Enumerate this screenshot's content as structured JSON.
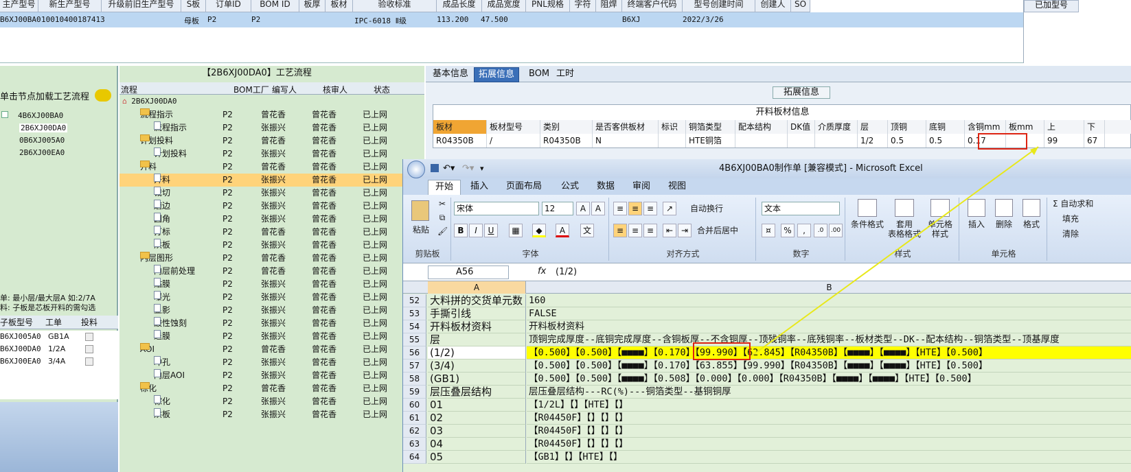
{
  "top_grid": {
    "headers": [
      "主产型号",
      "新生产型号",
      "升级前旧生产型号",
      "S板",
      "订单ID",
      "BOM ID",
      "板厚",
      "板材",
      "验收标准",
      "成品长度",
      "成品宽度",
      "PNL规格",
      "字符",
      "阻焊",
      "终端客户代码",
      "型号创建时间",
      "创建人",
      "SO"
    ],
    "row": {
      "model": "B6XJ00BA0",
      "new_model": "10010400187413",
      "board_type": "母板",
      "order": "P2",
      "bom": "P2",
      "standard": "IPC-6018 Ⅱ级",
      "length": "113.200",
      "width": "47.500",
      "customer": "B6XJ",
      "created": "2022/3/26"
    },
    "right_header": "已加型号"
  },
  "left_panel": {
    "hint": "单击节点加载工艺流程",
    "tree": [
      "4B6XJ00BA0",
      "2B6XJ00DA0",
      "0B6XJ005A0",
      "2B6XJ00EA0"
    ],
    "notice_1": "单: 最小层/最大层A 如:2/7A",
    "notice_2": "料: 子板是芯板开料的需勾选",
    "sub_headers": [
      "子板型号",
      "工单",
      "投料"
    ],
    "sub_rows": [
      {
        "model": "B6XJ005A0",
        "order": "GB1A"
      },
      {
        "model": "B6XJ00DA0",
        "order": "1/2A"
      },
      {
        "model": "B6XJ00EA0",
        "order": "3/4A"
      }
    ]
  },
  "flow_panel": {
    "title": "【2B6XJ00DA0】工艺流程",
    "headers": [
      "流程",
      "BOM工厂",
      "编写人",
      "核审人",
      "状态"
    ],
    "root": "2B6XJ00DA0",
    "rows": [
      {
        "name": "流程指示",
        "level": 1,
        "folder": true,
        "bom": "P2",
        "writer": "曾花香",
        "reviewer": "曾花香",
        "status": "已上网"
      },
      {
        "name": "流程指示",
        "level": 2,
        "folder": false,
        "bom": "P2",
        "writer": "张振兴",
        "reviewer": "曾花香",
        "status": "已上网"
      },
      {
        "name": "计划投料",
        "level": 1,
        "folder": true,
        "bom": "P2",
        "writer": "曾花香",
        "reviewer": "曾花香",
        "status": "已上网"
      },
      {
        "name": "计划投料",
        "level": 2,
        "folder": false,
        "bom": "P2",
        "writer": "张振兴",
        "reviewer": "曾花香",
        "status": "已上网"
      },
      {
        "name": "开料",
        "level": 1,
        "folder": true,
        "bom": "P2",
        "writer": "曾花香",
        "reviewer": "曾花香",
        "status": "已上网"
      },
      {
        "name": "开料",
        "level": 2,
        "folder": false,
        "bom": "P2",
        "writer": "张振兴",
        "reviewer": "曾花香",
        "status": "已上网",
        "selected": true
      },
      {
        "name": "裁切",
        "level": 2,
        "folder": false,
        "bom": "P2",
        "writer": "张振兴",
        "reviewer": "曾花香",
        "status": "已上网"
      },
      {
        "name": "磨边",
        "level": 2,
        "folder": false,
        "bom": "P2",
        "writer": "张振兴",
        "reviewer": "曾花香",
        "status": "已上网"
      },
      {
        "name": "圆角",
        "level": 2,
        "folder": false,
        "bom": "P2",
        "writer": "张振兴",
        "reviewer": "曾花香",
        "status": "已上网"
      },
      {
        "name": "打标",
        "level": 2,
        "folder": false,
        "bom": "P2",
        "writer": "曾花香",
        "reviewer": "曾花香",
        "status": "已上网"
      },
      {
        "name": "烘板",
        "level": 2,
        "folder": false,
        "bom": "P2",
        "writer": "张振兴",
        "reviewer": "曾花香",
        "status": "已上网"
      },
      {
        "name": "内层图形",
        "level": 1,
        "folder": true,
        "bom": "P2",
        "writer": "曾花香",
        "reviewer": "曾花香",
        "status": "已上网"
      },
      {
        "name": "内层前处理",
        "level": 2,
        "folder": false,
        "bom": "P2",
        "writer": "曾花香",
        "reviewer": "曾花香",
        "status": "已上网"
      },
      {
        "name": "贴膜",
        "level": 2,
        "folder": false,
        "bom": "P2",
        "writer": "张振兴",
        "reviewer": "曾花香",
        "status": "已上网"
      },
      {
        "name": "曝光",
        "level": 2,
        "folder": false,
        "bom": "P2",
        "writer": "张振兴",
        "reviewer": "曾花香",
        "status": "已上网"
      },
      {
        "name": "显影",
        "level": 2,
        "folder": false,
        "bom": "P2",
        "writer": "张振兴",
        "reviewer": "曾花香",
        "status": "已上网"
      },
      {
        "name": "酸性蚀刻",
        "level": 2,
        "folder": false,
        "bom": "P2",
        "writer": "张振兴",
        "reviewer": "曾花香",
        "status": "已上网"
      },
      {
        "name": "退膜",
        "level": 2,
        "folder": false,
        "bom": "P2",
        "writer": "张振兴",
        "reviewer": "曾花香",
        "status": "已上网"
      },
      {
        "name": "AOI",
        "level": 1,
        "folder": true,
        "bom": "P2",
        "writer": "曾花香",
        "reviewer": "曾花香",
        "status": "已上网"
      },
      {
        "name": "冲孔",
        "level": 2,
        "folder": false,
        "bom": "P2",
        "writer": "张振兴",
        "reviewer": "曾花香",
        "status": "已上网"
      },
      {
        "name": "内层AOI",
        "level": 2,
        "folder": false,
        "bom": "P2",
        "writer": "张振兴",
        "reviewer": "曾花香",
        "status": "已上网"
      },
      {
        "name": "棕化",
        "level": 1,
        "folder": true,
        "bom": "P2",
        "writer": "曾花香",
        "reviewer": "曾花香",
        "status": "已上网"
      },
      {
        "name": "棕化",
        "level": 2,
        "folder": false,
        "bom": "P2",
        "writer": "张振兴",
        "reviewer": "曾花香",
        "status": "已上网"
      },
      {
        "name": "烘板",
        "level": 2,
        "folder": false,
        "bom": "P2",
        "writer": "张振兴",
        "reviewer": "曾花香",
        "status": "已上网"
      }
    ]
  },
  "info_panel": {
    "tabs": [
      "基本信息",
      "拓展信息",
      "BOM",
      "工时"
    ],
    "active_tab": "拓展信息",
    "section_title": "拓展信息",
    "table_title": "开料板材信息",
    "headers": [
      "板材",
      "板材型号",
      "类别",
      "是否客供板材",
      "标识",
      "铜箔类型",
      "配本结构",
      "DK值",
      "介质厚度",
      "层",
      "顶铜",
      "底铜",
      "含铜mm",
      "板mm",
      "上",
      "下"
    ],
    "row": [
      "R04350B",
      "/",
      "R04350B",
      "N",
      "",
      "HTE铜箔",
      "",
      "",
      "",
      "1/2",
      "0.5",
      "0.5",
      "0.17",
      "",
      "99",
      "67"
    ]
  },
  "excel": {
    "title": "4B6XJ00BA0制作单 [兼容模式] - Microsoft Excel",
    "tabs": [
      "开始",
      "插入",
      "页面布局",
      "公式",
      "数据",
      "审阅",
      "视图"
    ],
    "active_tab": "开始",
    "ribbon": {
      "paste": "粘贴",
      "clipboard": "剪贴板",
      "font_name": "宋体",
      "font_size": "12",
      "font": "字体",
      "wrap": "自动换行",
      "merge": "合并后居中",
      "align": "对齐方式",
      "num_format": "文本",
      "number": "数字",
      "cond": "条件格式",
      "table_fmt_1": "套用",
      "table_fmt_2": "表格格式",
      "cell_style_1": "单元格",
      "cell_style_2": "样式",
      "styles": "样式",
      "insert": "插入",
      "delete": "删除",
      "format": "格式",
      "cells": "单元格",
      "autosum": "Σ 自动求和",
      "fill": "填充",
      "clear": "清除"
    },
    "name_box": "A56",
    "formula": "(1/2)",
    "col_a": "A",
    "col_b": "B",
    "rows": [
      {
        "n": "52",
        "a": "大料拼的交货单元数",
        "b": "160"
      },
      {
        "n": "53",
        "a": "手撕引线",
        "b": "FALSE"
      },
      {
        "n": "54",
        "a": "开料板材资料",
        "b": "开料板材资料"
      },
      {
        "n": "55",
        "a": "层",
        "b": "顶铜完成厚度--底铜完成厚度--含铜板厚--不含铜厚--顶残铜率--底残铜率--板材类型--DK--配本结构--铜箔类型--顶基厚度"
      },
      {
        "n": "56",
        "a": "(1/2)",
        "b": "【0.500】【0.500】【■■■■】【0.170】【99.990】【62.845】【R04350B】【■■■■】【■■■■】【HTE】【0.500】",
        "hl": true
      },
      {
        "n": "57",
        "a": "(3/4)",
        "b": "【0.500】【0.500】【■■■■】【0.170】【63.855】【99.990】【R04350B】【■■■■】【■■■■】【HTE】【0.500】"
      },
      {
        "n": "58",
        "a": "(GB1)",
        "b": "【0.500】【0.500】【■■■■】【0.508】【0.000】【0.000】【R04350B】【■■■■】【■■■■】【HTE】【0.500】"
      },
      {
        "n": "59",
        "a": "层压叠层结构",
        "b": "层压叠层结构---RC(%)---铜箔类型--基铜铜厚"
      },
      {
        "n": "60",
        "a": "01",
        "b": "【1/2L】【】【HTE】【】"
      },
      {
        "n": "61",
        "a": "02",
        "b": "【R04450F】【】【】【】"
      },
      {
        "n": "62",
        "a": "03",
        "b": "【R04450F】【】【】【】"
      },
      {
        "n": "63",
        "a": "04",
        "b": "【R04450F】【】【】【】"
      },
      {
        "n": "64",
        "a": "05",
        "b": "【GB1】【】【HTE】【】"
      }
    ]
  },
  "colors": {
    "highlight_row": "#ffff00",
    "selected_flow": "#ffd37a",
    "annotation_red": "#d21",
    "arrow": "#e8e81a",
    "panel_green": "#d6ead0",
    "excel_sheet": "#e2f0d9"
  }
}
